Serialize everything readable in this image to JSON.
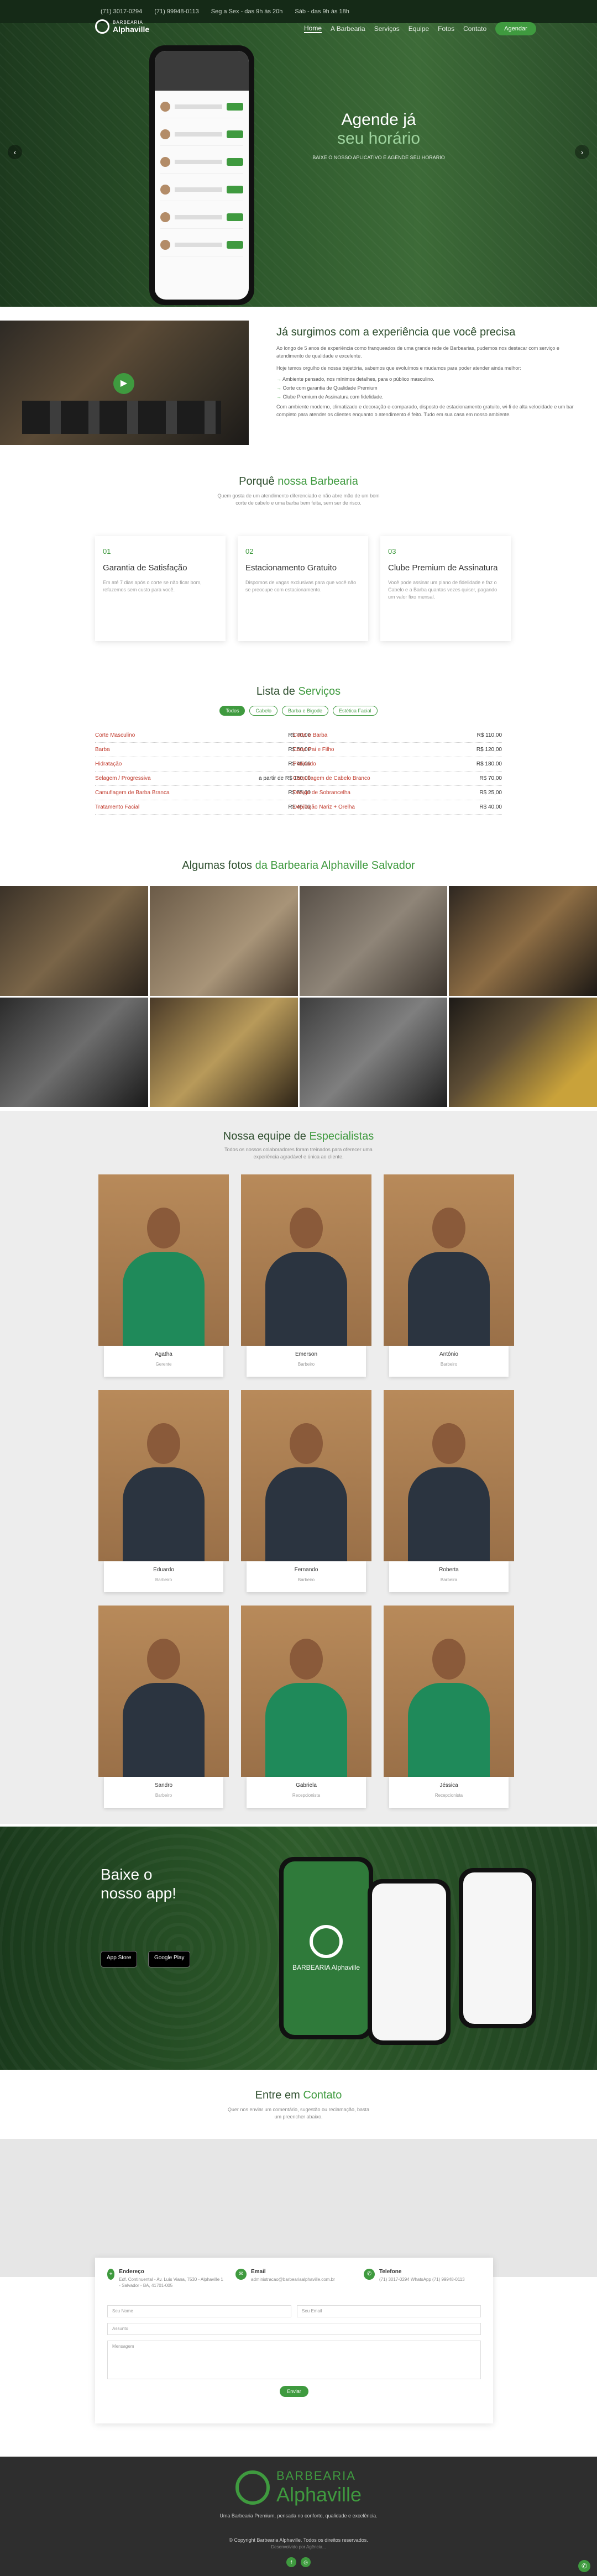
{
  "topbar": {
    "phone1": "(71) 3017-0294",
    "phone2": "(71) 99948-0113",
    "hours1": "Seg a Sex - das 9h às 20h",
    "hours2": "Sáb - das 9h às 18h"
  },
  "logo": {
    "top": "BARBEARIA",
    "bottom": "Alphaville"
  },
  "nav": {
    "items": [
      "Home",
      "A Barbearia",
      "Serviços",
      "Equipe",
      "Fotos",
      "Contato"
    ],
    "cta": "Agendar"
  },
  "hero": {
    "line1": "Agende já",
    "line2": "seu horário",
    "small": "BAIXE O NOSSO APLICATIVO E AGENDE SEU HORÁRIO"
  },
  "about": {
    "title": "Já surgimos com a experiência que você precisa",
    "p1": "Ao longo de 5 anos de experiência como franqueados de uma grande rede de Barbearias, pudemos nos destacar com serviço e atendimento de qualidade e excelente.",
    "p2": "Hoje temos orgulho de nossa trajetória, sabemos que evoluímos e mudamos para poder atender ainda melhor:",
    "bullets": [
      "Ambiente pensado, nos mínimos detalhes, para o público masculino.",
      "Corte com garantia de Qualidade Premium",
      "Clube Premium de Assinatura com fidelidade."
    ],
    "p3": "Com ambiente moderno, climatizado e decoração e-comparado, disposto de estacionamento gratuito, wi-fi de alta velocidade e um bar completo para atender os clientes enquanto o atendimento é feito. Tudo em sua casa em nosso ambiente."
  },
  "why": {
    "title_a": "Porquê ",
    "title_b": "nossa Barbearia",
    "sub": "Quem gosta de um atendimento diferenciado e não abre mão de um bom corte de cabelo e uma barba bem feita, sem ser de risco.",
    "cards": [
      {
        "n": "01",
        "t": "Garantia de Satisfação",
        "d": "Em até 7 dias após o corte se não ficar bom, refazemos sem custo para você."
      },
      {
        "n": "02",
        "t": "Estacionamento Gratuito",
        "d": "Dispomos de vagas exclusivas para que você não se preocupe com estacionamento."
      },
      {
        "n": "03",
        "t": "Clube Premium de Assinatura",
        "d": "Você pode assinar um plano de fidelidade e faz o Cabelo e a Barba quantas vezes quiser, pagando um valor fixo mensal."
      }
    ]
  },
  "services": {
    "title_a": "Lista de ",
    "title_b": "Serviços",
    "tabs": [
      "Todos",
      "Cabelo",
      "Barba e Bigode",
      "Estética Facial"
    ],
    "left": [
      {
        "n": "Corte Masculino",
        "p": "R$ 70,00"
      },
      {
        "n": "Barba",
        "p": "R$ 50,00"
      },
      {
        "n": "Hidratação",
        "p": "R$ 45,00"
      },
      {
        "n": "Selagem / Progressiva",
        "p": "a partir de R$ 150,00"
      },
      {
        "n": "Camuflagem de Barba Branca",
        "p": "R$ 55,00"
      },
      {
        "n": "Tratamento Facial",
        "p": "R$ 45,00"
      }
    ],
    "right": [
      {
        "n": "Corte e Barba",
        "p": "R$ 110,00"
      },
      {
        "n": "Corte Pai e Filho",
        "p": "R$ 120,00"
      },
      {
        "n": "Platinado",
        "p": "R$ 180,00"
      },
      {
        "n": "Camuflagem de Cabelo Branco",
        "p": "R$ 70,00"
      },
      {
        "n": "Design de Sobrancelha",
        "p": "R$ 25,00"
      },
      {
        "n": "Depilação Nariz + Orelha",
        "p": "R$ 40,00"
      }
    ]
  },
  "photos": {
    "title_a": "Algumas fotos ",
    "title_b": "da Barbearia Alphaville Salvador"
  },
  "team": {
    "title_a": "Nossa equipe de ",
    "title_b": "Especialistas",
    "sub": "Todos os nossos colaboradores foram treinados para oferecer uma experiência agradável e única ao cliente.",
    "members": [
      {
        "n": "Agatha",
        "r": "Gerente",
        "g": true
      },
      {
        "n": "Emerson",
        "r": "Barbeiro",
        "g": false
      },
      {
        "n": "Antônio",
        "r": "Barbeiro",
        "g": false
      },
      {
        "n": "Eduardo",
        "r": "Barbeiro",
        "g": false
      },
      {
        "n": "Fernando",
        "r": "Barbeiro",
        "g": false
      },
      {
        "n": "Roberta",
        "r": "Barbeira",
        "g": false
      },
      {
        "n": "Sandro",
        "r": "Barbeiro",
        "g": false
      },
      {
        "n": "Gabriela",
        "r": "Recepcionista",
        "g": true
      },
      {
        "n": "Jéssica",
        "r": "Recepcionista",
        "g": true
      }
    ]
  },
  "app": {
    "title": "Baixe o nosso app!",
    "appstore": "App Store",
    "googleplay": "Google Play",
    "phone_brand": "BARBEARIA Alphaville"
  },
  "contact": {
    "title_a": "Entre em ",
    "title_b": "Contato",
    "sub": "Quer nos enviar um comentário, sugestão ou reclamação, basta um preencher abaixo."
  },
  "form": {
    "addr_label": "Endereço",
    "addr_val": "Edf. Continuental - Av. Luís Viana, 7530 - Alphaville 1 - Salvador - BA, 41701-005",
    "email_label": "Email",
    "email_val": "administracao@barbeariaalphaville.com.br",
    "tel_label": "Telefone",
    "tel_val": "(71) 3017-0294 WhatsApp (71) 99948-0113",
    "ph_name": "Seu Nome",
    "ph_email": "Seu Email",
    "ph_subject": "Assunto",
    "ph_msg": "Mensagem",
    "send": "Enviar"
  },
  "footer": {
    "l1": "BARBEARIA",
    "l2": "Alphaville",
    "tag": "Uma Barbearia Premium, pensada no conforto, qualidade e excelência.",
    "copy": "© Copyright Barbearia Alphaville. Todos os direitos reservados.",
    "cred": "Desenvolvido por Agência..."
  }
}
